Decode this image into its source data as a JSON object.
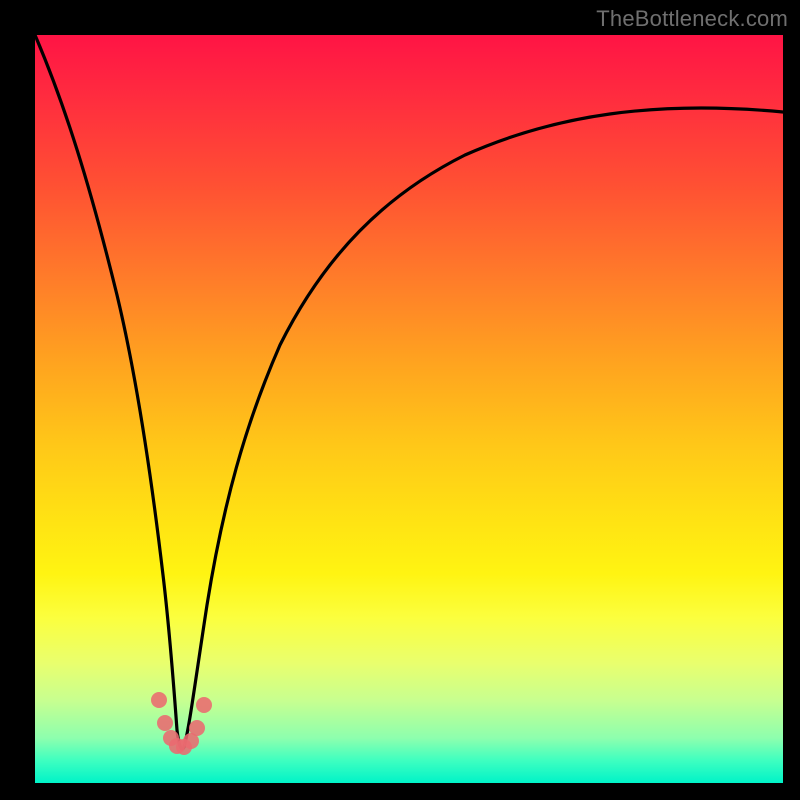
{
  "watermark": "TheBottleneck.com",
  "colors": {
    "frame": "#000000",
    "curve": "#000000",
    "marker": "#ea6a6f",
    "gradient_top": "#ff1445",
    "gradient_bottom": "#00f3c8"
  },
  "chart_data": {
    "type": "line",
    "title": "",
    "xlabel": "",
    "ylabel": "",
    "xlim": [
      0,
      100
    ],
    "ylim": [
      0,
      100
    ],
    "note": "Axes are percent of plot area. y=100 is top (worst/red), y=0 is bottom (best/green). Curve is the bottleneck V-profile with minimum near x≈19.",
    "series": [
      {
        "name": "bottleneck-curve",
        "x": [
          0,
          2,
          4,
          6,
          8,
          10,
          12,
          14,
          16,
          17,
          18,
          19,
          20,
          21,
          22,
          24,
          28,
          32,
          36,
          40,
          45,
          50,
          55,
          60,
          65,
          70,
          75,
          80,
          85,
          90,
          95,
          100
        ],
        "y": [
          100,
          92,
          84,
          75,
          66,
          56,
          46,
          35,
          22,
          15,
          9,
          5,
          6,
          9,
          14,
          23,
          36,
          46,
          53,
          59,
          65,
          70,
          74,
          77,
          80,
          82.5,
          84.5,
          86,
          87.2,
          88.2,
          89,
          89.7
        ]
      },
      {
        "name": "minimum-markers",
        "x": [
          16.5,
          17.3,
          18.1,
          19.0,
          19.9,
          20.7,
          21.5,
          22.4
        ],
        "y": [
          11,
          8,
          6,
          5,
          5.5,
          7,
          9,
          12
        ]
      }
    ]
  }
}
